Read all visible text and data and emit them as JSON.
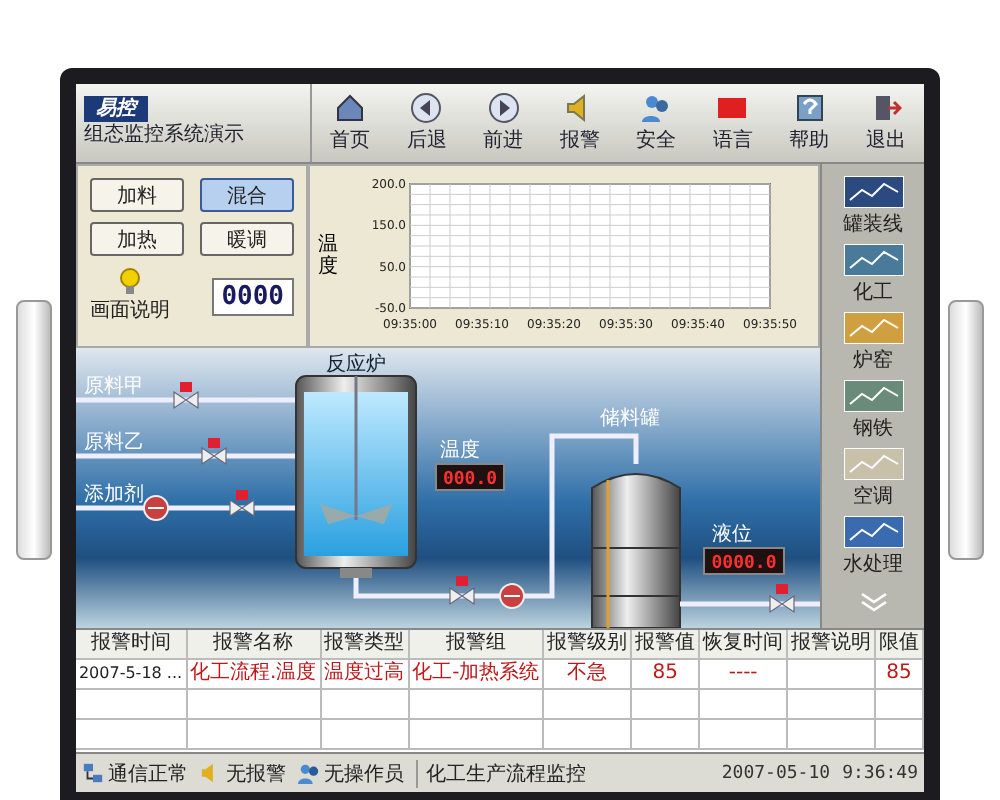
{
  "header": {
    "logo": "易控",
    "subtitle": "组态监控系统演示"
  },
  "toolbar": [
    {
      "label": "首页"
    },
    {
      "label": "后退"
    },
    {
      "label": "前进"
    },
    {
      "label": "报警"
    },
    {
      "label": "安全"
    },
    {
      "label": "语言"
    },
    {
      "label": "帮助"
    },
    {
      "label": "退出"
    }
  ],
  "controls": {
    "buttons": [
      {
        "label": "加料",
        "selected": false
      },
      {
        "label": "混合",
        "selected": true
      },
      {
        "label": "加热",
        "selected": false
      },
      {
        "label": "暖调",
        "selected": false
      }
    ],
    "help_label": "画面说明",
    "counter": "0000"
  },
  "trend_chart": {
    "y_label": "温度",
    "y_ticks": [
      "200.0",
      "150.0",
      "50.0",
      "-50.0"
    ],
    "x_ticks": [
      "09:35:00",
      "09:35:10",
      "09:35:20",
      "09:35:30",
      "09:35:40",
      "09:35:50"
    ]
  },
  "process": {
    "reactor_label": "反应炉",
    "inputs": [
      "原料甲",
      "原料乙",
      "添加剂"
    ],
    "temperature_label": "温度",
    "temperature_value": "000.0",
    "tank_label": "储料罐",
    "level_label": "液位",
    "level_value": "0000.0"
  },
  "sidebar": [
    {
      "label": "罐装线"
    },
    {
      "label": "化工"
    },
    {
      "label": "炉窑"
    },
    {
      "label": "钢铁"
    },
    {
      "label": "空调"
    },
    {
      "label": "水处理"
    }
  ],
  "alarm_table": {
    "columns": [
      "报警时间",
      "报警名称",
      "报警类型",
      "报警组",
      "报警级别",
      "报警值",
      "恢复时间",
      "报警说明",
      "限值"
    ],
    "rows": [
      [
        "2007-5-18 ...",
        "化工流程.温度",
        "温度过高",
        "化工-加热系统",
        "不急",
        "85",
        "----",
        "",
        "85"
      ]
    ]
  },
  "status_bar": {
    "items": [
      "通信正常",
      "无报警",
      "无操作员"
    ],
    "screen_title": "化工生产流程监控",
    "date": "2007-05-10",
    "time": "9:36:49"
  }
}
